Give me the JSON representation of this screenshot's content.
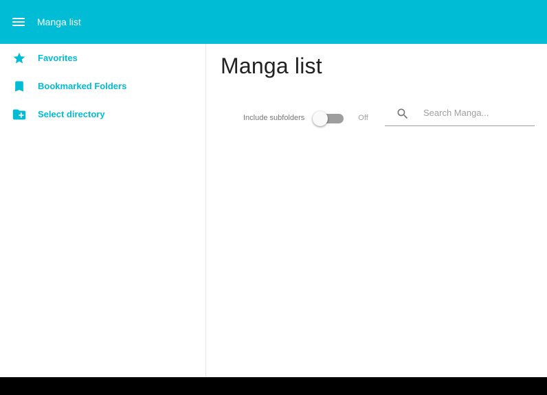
{
  "header": {
    "title": "Manga list",
    "menu_icon": "menu-icon"
  },
  "sidebar": {
    "items": [
      {
        "label": "Favorites",
        "icon": "star-icon"
      },
      {
        "label": "Bookmarked Folders",
        "icon": "bookmark-icon"
      },
      {
        "label": "Select directory",
        "icon": "folder-add-icon"
      }
    ]
  },
  "main": {
    "title": "Manga list",
    "subfolders": {
      "label": "Include subfolders",
      "state": "Off",
      "checked": false
    },
    "search": {
      "placeholder": "Search Manga...",
      "value": "",
      "icon": "search-icon"
    }
  },
  "colors": {
    "accent": "#00bcd4",
    "text": "#212121"
  }
}
